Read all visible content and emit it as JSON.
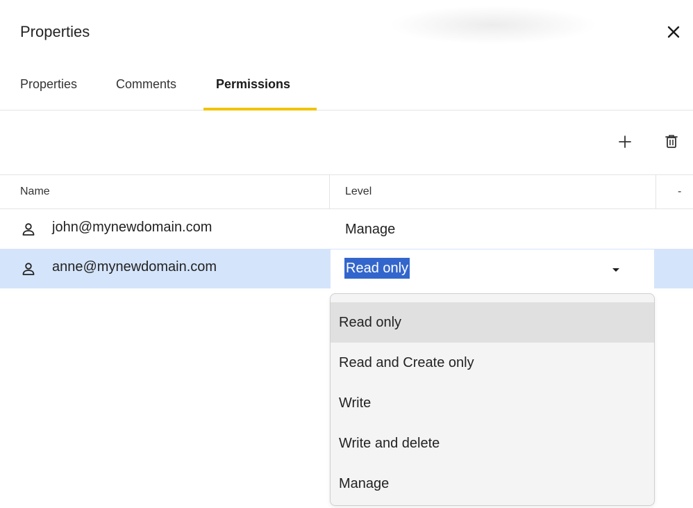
{
  "panel": {
    "title": "Properties",
    "close_icon": "close-icon"
  },
  "tabs": [
    {
      "label": "Properties",
      "active": false
    },
    {
      "label": "Comments",
      "active": false
    },
    {
      "label": "Permissions",
      "active": true
    }
  ],
  "accent_color": "#f0c400",
  "selection_color": "#d4e4fb",
  "toolbar": {
    "add_icon": "plus-icon",
    "delete_icon": "trash-icon"
  },
  "grid": {
    "columns": [
      "Name",
      "Level",
      "-"
    ],
    "rows": [
      {
        "name": "john@mynewdomain.com",
        "level": "Manage",
        "icon": "user-icon"
      },
      {
        "name": "anne@mynewdomain.com",
        "level": "Read only",
        "icon": "user-icon",
        "selected": true,
        "editing": true
      }
    ]
  },
  "level_dropdown": {
    "options": [
      "Read only",
      "Read and Create only",
      "Write",
      "Write and delete",
      "Manage"
    ],
    "highlighted": "Read only"
  }
}
